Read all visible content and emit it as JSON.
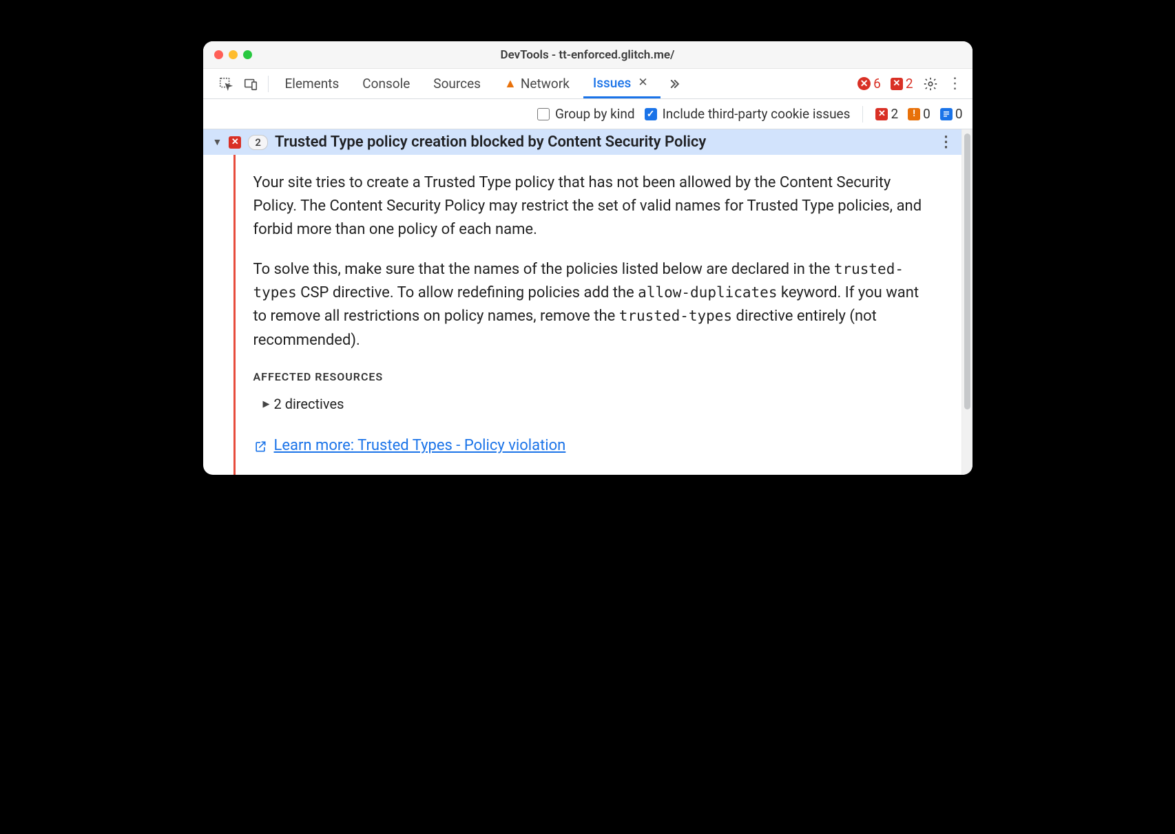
{
  "window": {
    "title": "DevTools - tt-enforced.glitch.me/"
  },
  "tabs": {
    "elements": "Elements",
    "console": "Console",
    "sources": "Sources",
    "network": "Network",
    "issues": "Issues"
  },
  "toolbar_counts": {
    "errors": "6",
    "page_errors": "2"
  },
  "filters": {
    "group_by_kind": "Group by kind",
    "include_third_party": "Include third-party cookie issues"
  },
  "issue_counts": {
    "red": "2",
    "orange": "0",
    "blue": "0"
  },
  "issue": {
    "count": "2",
    "title": "Trusted Type policy creation blocked by Content Security Policy",
    "para1": "Your site tries to create a Trusted Type policy that has not been allowed by the Content Security Policy. The Content Security Policy may restrict the set of valid names for Trusted Type policies, and forbid more than one policy of each name.",
    "para2_a": "To solve this, make sure that the names of the policies listed below are declared in the ",
    "code1": "trusted-types",
    "para2_b": " CSP directive. To allow redefining policies add the ",
    "code2": "allow-duplicates",
    "para2_c": " keyword. If you want to remove all restrictions on policy names, remove the ",
    "code3": "trusted-types",
    "para2_d": " directive entirely (not recommended).",
    "affected_label": "AFFECTED RESOURCES",
    "directives": "2 directives",
    "learn_more": "Learn more: Trusted Types - Policy violation"
  }
}
